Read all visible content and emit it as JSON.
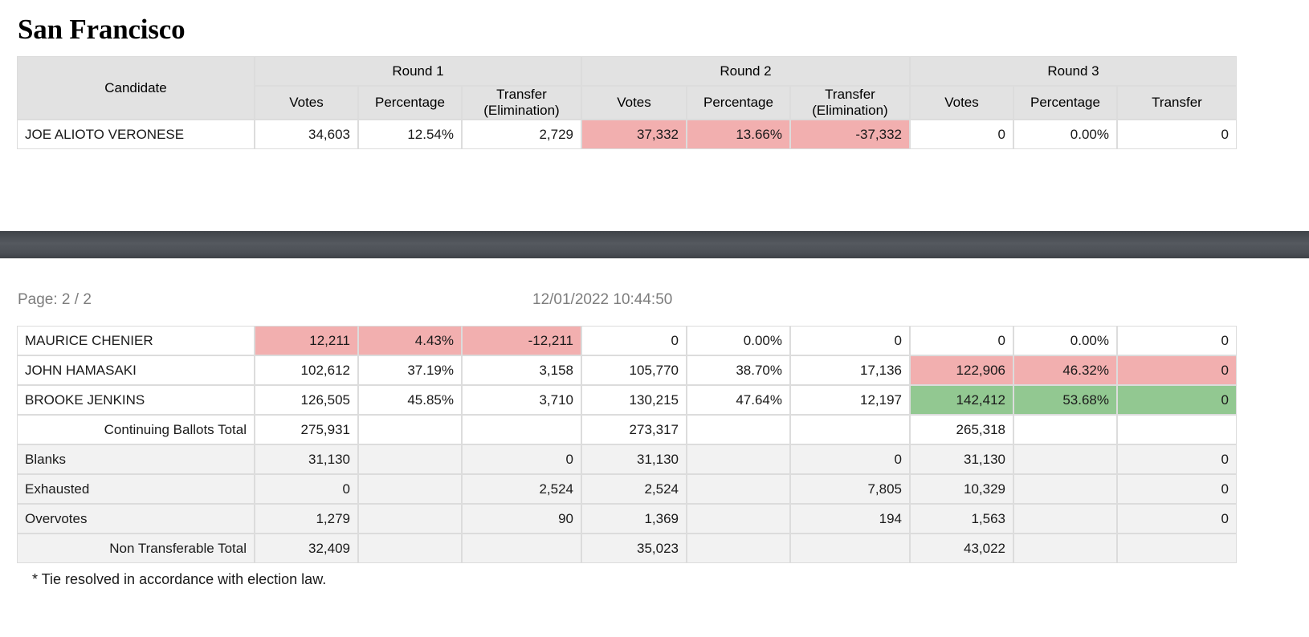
{
  "report": {
    "title": "San Francisco",
    "page_indicator": "Page: 2 / 2",
    "timestamp": "12/01/2022 10:44:50",
    "footnote": "* Tie resolved in accordance with election law."
  },
  "colors": {
    "header_background": "#E2E2E2",
    "eliminated_highlight": "#F2AFAF",
    "winner_highlight": "#92C891",
    "shaded_row": "#F2F2F2",
    "divider_bar": "#4A4E54",
    "muted_text": "#7D7D7D"
  },
  "header": {
    "candidate": "Candidate",
    "groups": [
      "Round 1",
      "Round 2",
      "Round 3"
    ],
    "subs": [
      "Votes",
      "Percentage",
      "Transfer (Elimination)",
      "Votes",
      "Percentage",
      "Transfer (Elimination)",
      "Votes",
      "Percentage",
      "Transfer"
    ],
    "sub_labels": {
      "votes": "Votes",
      "percentage": "Percentage",
      "transfer_elimination_line1": "Transfer",
      "transfer_elimination_line2": "(Elimination)",
      "transfer": "Transfer"
    }
  },
  "top_rows": [
    {
      "candidate": "JOE ALIOTO VERONESE",
      "r1_votes": "34,603",
      "r1_pct": "12.54%",
      "r1_transfer": "2,729",
      "r2_votes": "37,332",
      "r2_pct": "13.66%",
      "r2_transfer": "-37,332",
      "r3_votes": "0",
      "r3_pct": "0.00%",
      "r3_transfer": "0",
      "highlight": {
        "r1": "none",
        "r2": "eliminated",
        "r3": "none"
      }
    }
  ],
  "bottom_rows": [
    {
      "candidate": "MAURICE CHENIER",
      "r1_votes": "12,211",
      "r1_pct": "4.43%",
      "r1_transfer": "-12,211",
      "r2_votes": "0",
      "r2_pct": "0.00%",
      "r2_transfer": "0",
      "r3_votes": "0",
      "r3_pct": "0.00%",
      "r3_transfer": "0",
      "highlight": {
        "r1": "eliminated",
        "r2": "none",
        "r3": "none"
      }
    },
    {
      "candidate": "JOHN HAMASAKI",
      "r1_votes": "102,612",
      "r1_pct": "37.19%",
      "r1_transfer": "3,158",
      "r2_votes": "105,770",
      "r2_pct": "38.70%",
      "r2_transfer": "17,136",
      "r3_votes": "122,906",
      "r3_pct": "46.32%",
      "r3_transfer": "0",
      "highlight": {
        "r1": "none",
        "r2": "none",
        "r3": "eliminated"
      }
    },
    {
      "candidate": "BROOKE JENKINS",
      "r1_votes": "126,505",
      "r1_pct": "45.85%",
      "r1_transfer": "3,710",
      "r2_votes": "130,215",
      "r2_pct": "47.64%",
      "r2_transfer": "12,197",
      "r3_votes": "142,412",
      "r3_pct": "53.68%",
      "r3_transfer": "0",
      "highlight": {
        "r1": "none",
        "r2": "none",
        "r3": "winner"
      }
    }
  ],
  "summary_rows": [
    {
      "label": "Continuing Ballots Total",
      "style": "total",
      "r1_votes": "275,931",
      "r1_pct": "",
      "r1_transfer": "",
      "r2_votes": "273,317",
      "r2_pct": "",
      "r2_transfer": "",
      "r3_votes": "265,318",
      "r3_pct": "",
      "r3_transfer": ""
    },
    {
      "label": "Blanks",
      "style": "detail",
      "r1_votes": "31,130",
      "r1_pct": "",
      "r1_transfer": "0",
      "r2_votes": "31,130",
      "r2_pct": "",
      "r2_transfer": "0",
      "r3_votes": "31,130",
      "r3_pct": "",
      "r3_transfer": "0"
    },
    {
      "label": "Exhausted",
      "style": "detail",
      "r1_votes": "0",
      "r1_pct": "",
      "r1_transfer": "2,524",
      "r2_votes": "2,524",
      "r2_pct": "",
      "r2_transfer": "7,805",
      "r3_votes": "10,329",
      "r3_pct": "",
      "r3_transfer": "0"
    },
    {
      "label": "Overvotes",
      "style": "detail",
      "r1_votes": "1,279",
      "r1_pct": "",
      "r1_transfer": "90",
      "r2_votes": "1,369",
      "r2_pct": "",
      "r2_transfer": "194",
      "r3_votes": "1,563",
      "r3_pct": "",
      "r3_transfer": "0"
    },
    {
      "label": "Non Transferable Total",
      "style": "total-shaded",
      "r1_votes": "32,409",
      "r1_pct": "",
      "r1_transfer": "",
      "r2_votes": "35,023",
      "r2_pct": "",
      "r2_transfer": "",
      "r3_votes": "43,022",
      "r3_pct": "",
      "r3_transfer": ""
    }
  ]
}
